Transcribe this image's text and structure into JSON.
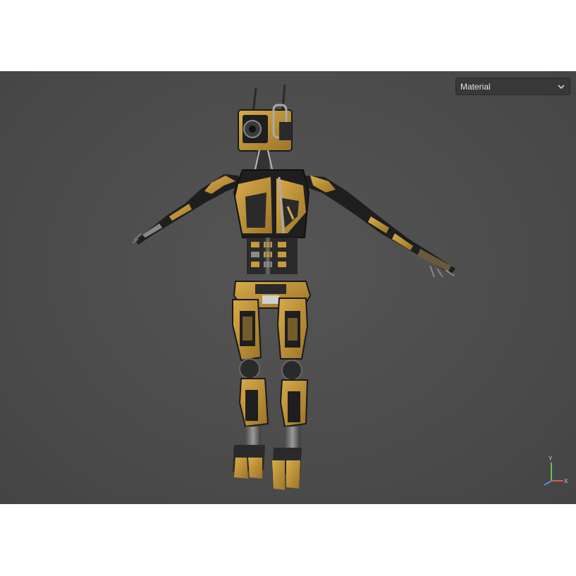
{
  "viewport": {
    "background": "#4c4c4c",
    "shading_mode": {
      "selected": "Material",
      "icon": "chevron-down-icon"
    },
    "axis_gizmo": {
      "x_label": "X",
      "y_label": "Y",
      "colors": {
        "x": "#e05a4f",
        "y": "#6cc24a",
        "z": "#5a8de0"
      }
    },
    "model": {
      "colors": {
        "primary": "#c89a3a",
        "dark": "#1e1e1e",
        "metal": "#7a7a7a"
      }
    }
  }
}
